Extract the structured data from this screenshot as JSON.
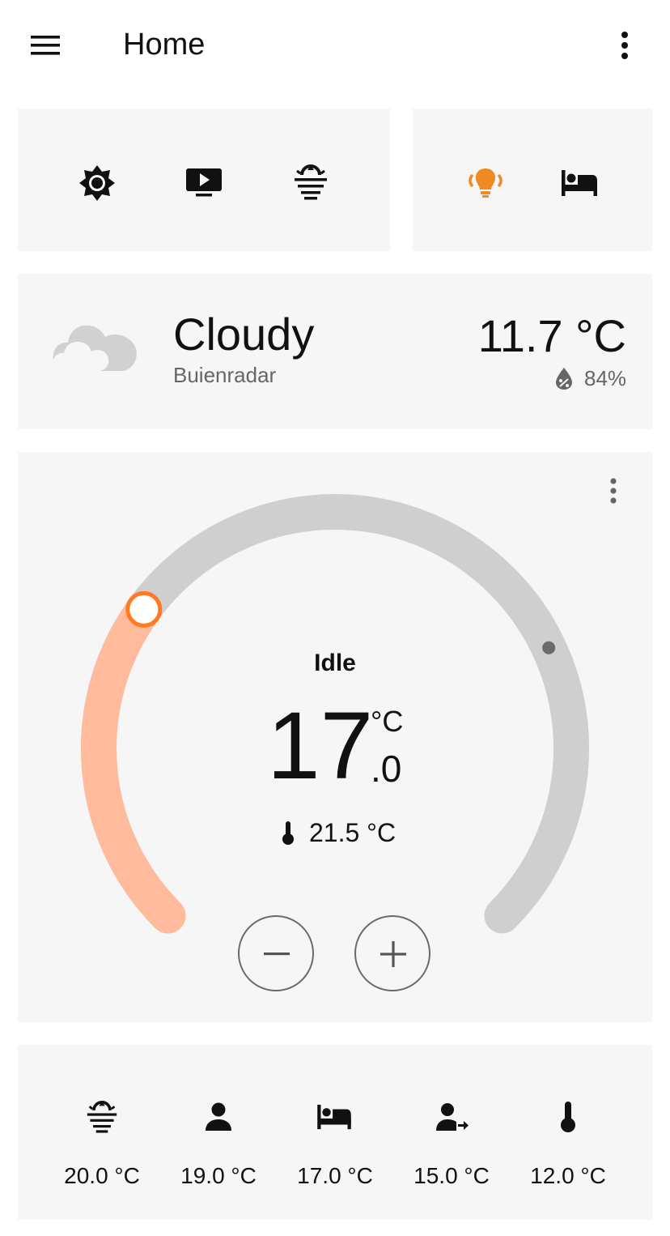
{
  "header": {
    "title": "Home",
    "menu_icon": "menu-icon",
    "more_icon": "more-vert-icon"
  },
  "scenes_card": {
    "buttons": [
      {
        "name": "brightness-icon",
        "state": "off"
      },
      {
        "name": "tv-play-icon",
        "state": "off"
      },
      {
        "name": "sunrise-icon",
        "state": "off"
      }
    ]
  },
  "rooms_card": {
    "buttons": [
      {
        "name": "lights-icon",
        "state": "on",
        "color": "#f08a24"
      },
      {
        "name": "bed-icon",
        "state": "off"
      }
    ]
  },
  "weather": {
    "condition": "Cloudy",
    "source": "Buienradar",
    "temperature": "11.7 °C",
    "humidity": "84%",
    "icon": "cloudy-icon",
    "humidity_icon": "humidity-drop-icon"
  },
  "thermostat": {
    "state": "Idle",
    "target_whole": "17",
    "target_unit": "°C",
    "target_decimal": ".0",
    "current": "21.5 °C",
    "thermometer_icon": "thermometer-icon",
    "target_level_fraction": 0.3,
    "current_level_fraction": 0.74,
    "active_color": "#ffbb9c",
    "handle_color": "#ff7a22",
    "track_color": "#cfcfd0",
    "minus_icon": "minus-icon",
    "plus_icon": "plus-icon"
  },
  "presets": [
    {
      "icon": "sunrise-icon",
      "label": "20.0 °C"
    },
    {
      "icon": "person-icon",
      "label": "19.0 °C"
    },
    {
      "icon": "bed-icon",
      "label": "17.0 °C"
    },
    {
      "icon": "person-leave-icon",
      "label": "15.0 °C"
    },
    {
      "icon": "thermometer-icon",
      "label": "12.0 °C"
    }
  ],
  "colors": {
    "accent": "#f08a24",
    "card_bg": "#f6f6f6",
    "secondary_text": "#666666"
  }
}
